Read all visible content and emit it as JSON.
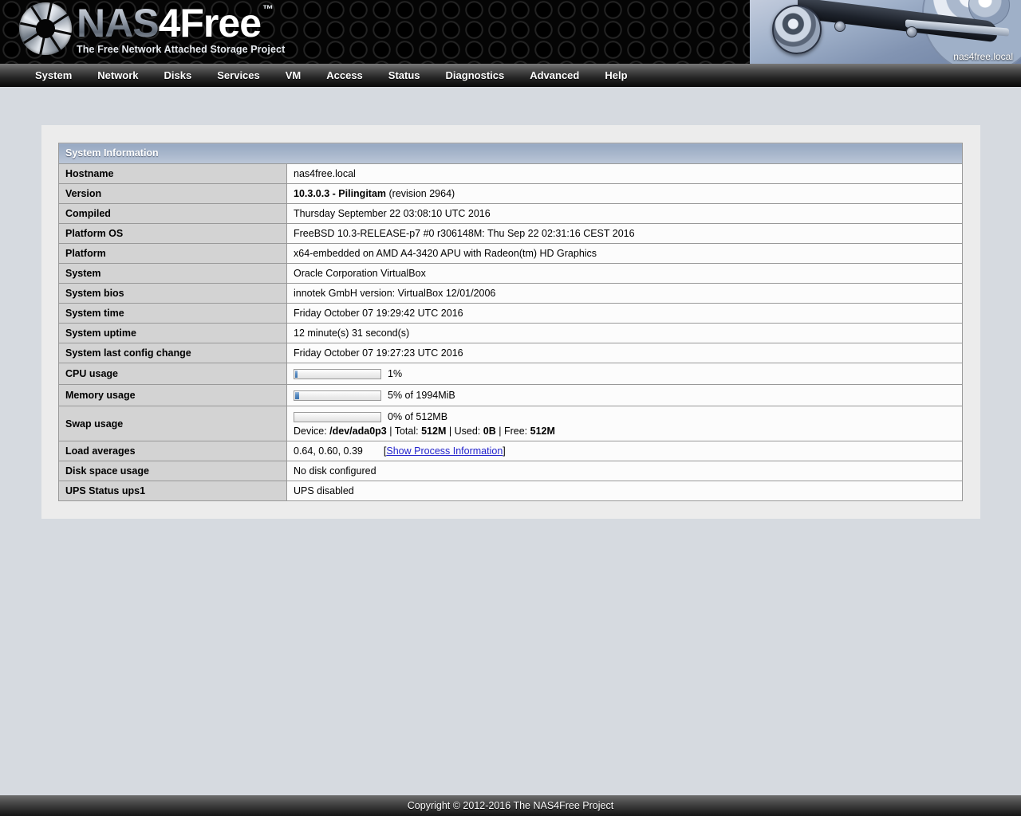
{
  "header": {
    "logo_nas": "NAS",
    "logo_4free": "4Free",
    "logo_tm": "™",
    "tagline": "The Free Network Attached Storage Project",
    "hostname_badge": "nas4free.local"
  },
  "nav": {
    "items": [
      {
        "label": "System"
      },
      {
        "label": "Network"
      },
      {
        "label": "Disks"
      },
      {
        "label": "Services"
      },
      {
        "label": "VM"
      },
      {
        "label": "Access"
      },
      {
        "label": "Status"
      },
      {
        "label": "Diagnostics"
      },
      {
        "label": "Advanced"
      },
      {
        "label": "Help"
      }
    ]
  },
  "panel": {
    "title": "System Information",
    "rows": {
      "hostname": {
        "label": "Hostname",
        "value": "nas4free.local"
      },
      "version": {
        "label": "Version",
        "value_bold": "10.3.0.3 - Pilingitam",
        "value_rest": "(revision 2964)"
      },
      "compiled": {
        "label": "Compiled",
        "value": "Thursday September 22 03:08:10 UTC 2016"
      },
      "platform_os": {
        "label": "Platform OS",
        "value": "FreeBSD 10.3-RELEASE-p7 #0 r306148M: Thu Sep 22 02:31:16 CEST 2016"
      },
      "platform": {
        "label": "Platform",
        "value": "x64-embedded on AMD A4-3420 APU with Radeon(tm) HD Graphics"
      },
      "system": {
        "label": "System",
        "value": "Oracle Corporation VirtualBox"
      },
      "system_bios": {
        "label": "System bios",
        "value": "innotek GmbH version: VirtualBox 12/01/2006"
      },
      "system_time": {
        "label": "System time",
        "value": "Friday October 07 19:29:42 UTC 2016"
      },
      "system_uptime": {
        "label": "System uptime",
        "value": "12 minute(s) 31 second(s)"
      },
      "last_config_change": {
        "label": "System last config change",
        "value": "Friday October 07 19:27:23 UTC 2016"
      },
      "cpu_usage": {
        "label": "CPU usage",
        "percent": 1,
        "text": "1%"
      },
      "memory_usage": {
        "label": "Memory usage",
        "percent": 5,
        "text": "5% of 1994MiB"
      },
      "swap_usage": {
        "label": "Swap usage",
        "percent": 0,
        "text": "0% of 512MB",
        "detail_device_label": "Device:",
        "detail_device": "/dev/ada0p3",
        "detail_sep1": "|",
        "detail_total_label": "Total:",
        "detail_total": "512M",
        "detail_sep2": "|",
        "detail_used_label": "Used:",
        "detail_used": "0B",
        "detail_sep3": "|",
        "detail_free_label": "Free:",
        "detail_free": "512M"
      },
      "load_averages": {
        "label": "Load averages",
        "value": "0.64, 0.60, 0.39",
        "link_open": "[",
        "link_text": "Show Process Information",
        "link_close": "]"
      },
      "disk_space": {
        "label": "Disk space usage",
        "value": "No disk configured"
      },
      "ups_status": {
        "label": "UPS Status ups1",
        "value": "UPS disabled"
      }
    }
  },
  "footer": {
    "copyright": "Copyright © 2012-2016 The NAS4Free Project"
  }
}
